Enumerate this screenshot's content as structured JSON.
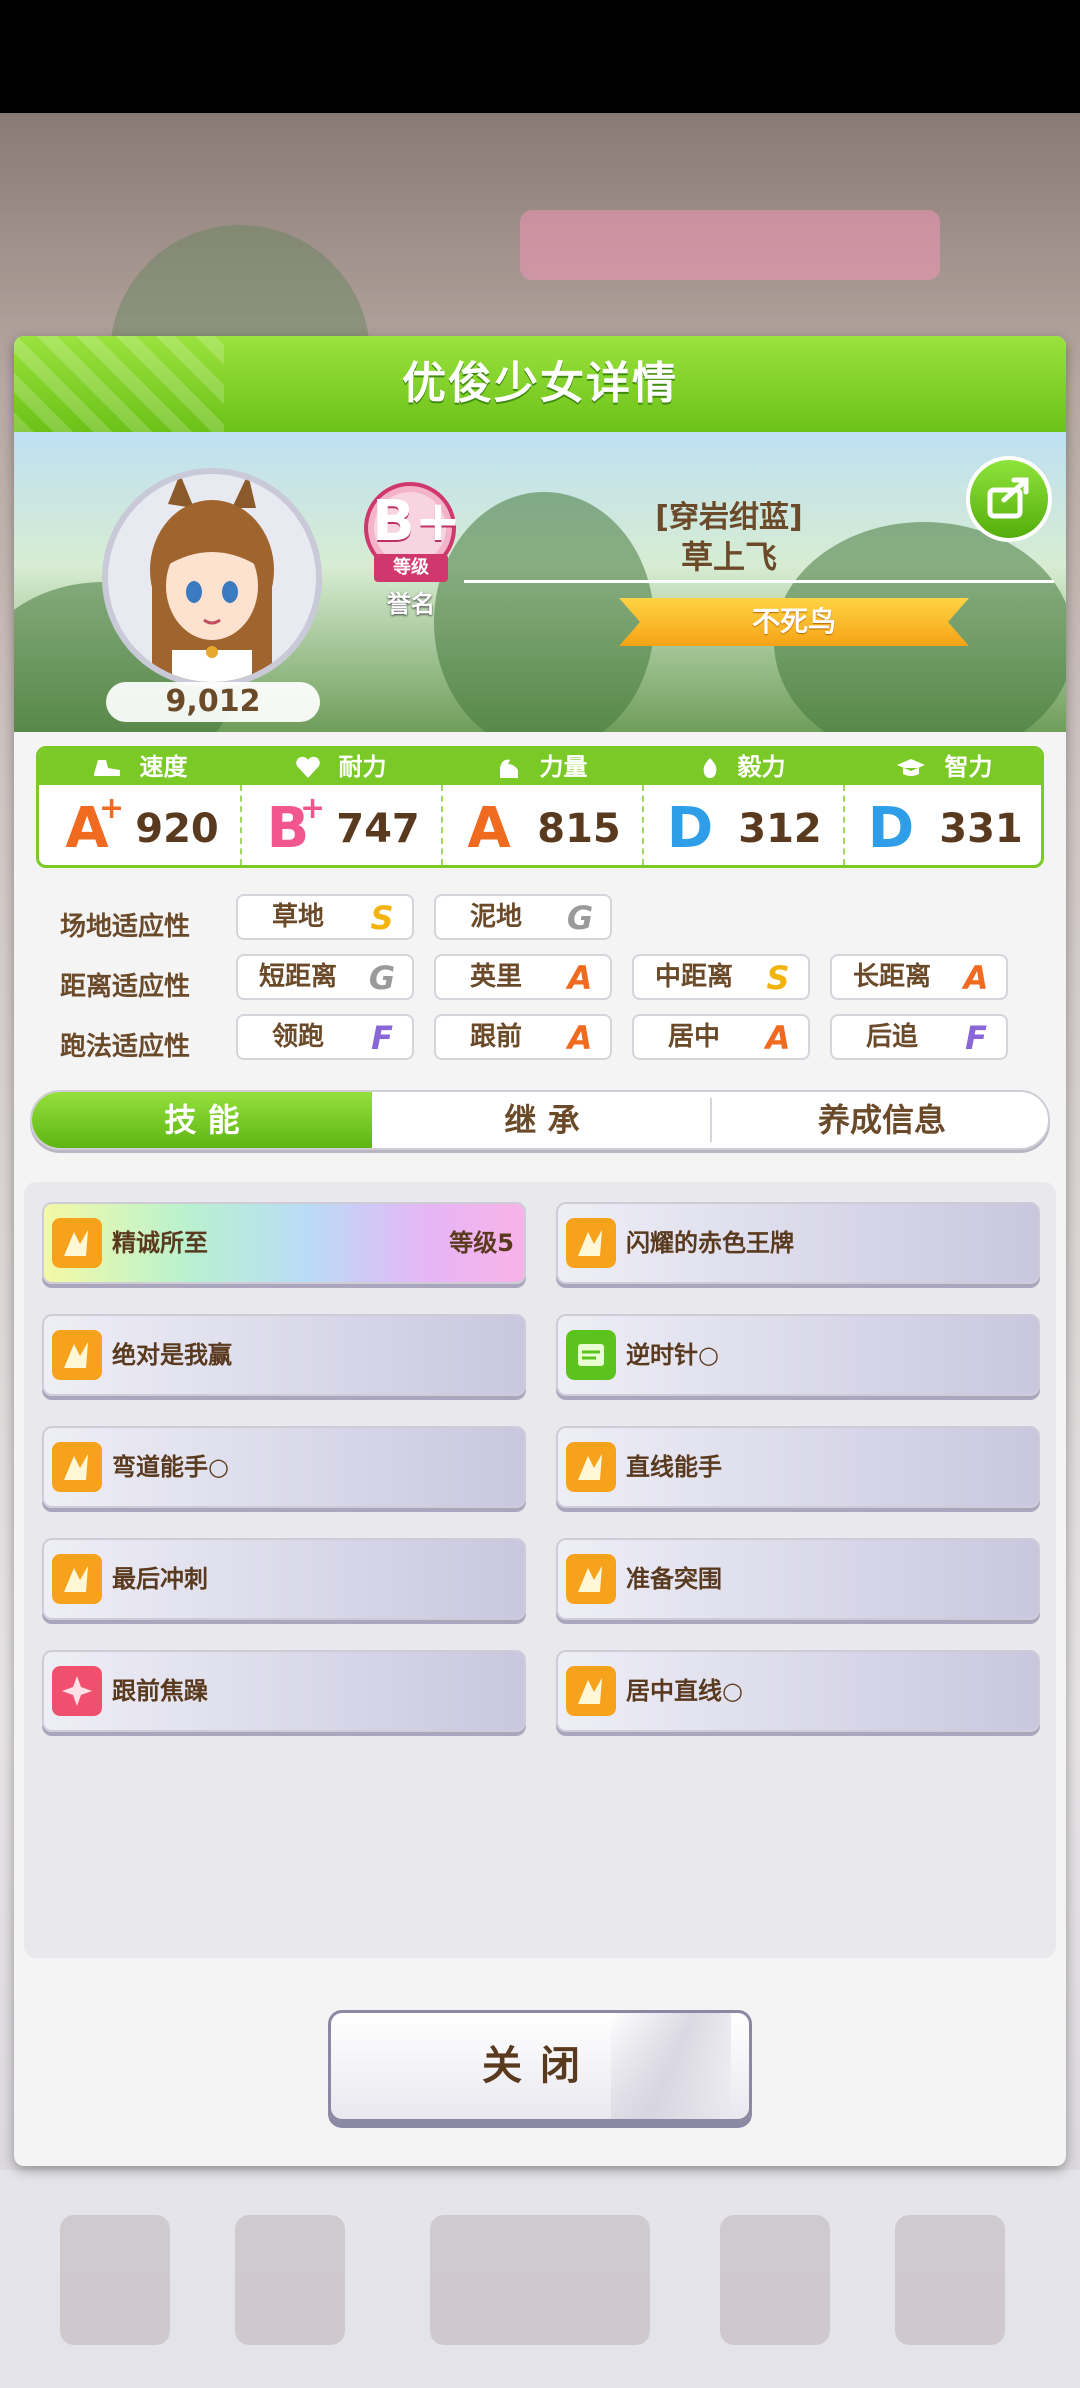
{
  "header": {
    "title": "优俊少女详情"
  },
  "profile": {
    "fans": "9,012",
    "rank": "B+",
    "rank_label": "等级",
    "reputation_label": "誉名",
    "epithet": "[穿岩绀蓝]",
    "name": "草上飞",
    "title": "不死鸟"
  },
  "stats": [
    {
      "label": "速度",
      "grade": "A",
      "plus": "+",
      "value": "920",
      "icon": "shoe-icon"
    },
    {
      "label": "耐力",
      "grade": "B",
      "plus": "+",
      "value": "747",
      "icon": "heart-icon"
    },
    {
      "label": "力量",
      "grade": "A",
      "plus": "",
      "value": "815",
      "icon": "muscle-icon"
    },
    {
      "label": "毅力",
      "grade": "D",
      "plus": "",
      "value": "312",
      "icon": "flame-icon"
    },
    {
      "label": "智力",
      "grade": "D",
      "plus": "",
      "value": "331",
      "icon": "graduation-cap-icon"
    }
  ],
  "aptitudes": {
    "track": {
      "label": "场地适应性",
      "items": [
        {
          "name": "草地",
          "grade": "S"
        },
        {
          "name": "泥地",
          "grade": "G"
        }
      ]
    },
    "distance": {
      "label": "距离适应性",
      "items": [
        {
          "name": "短距离",
          "grade": "G"
        },
        {
          "name": "英里",
          "grade": "A"
        },
        {
          "name": "中距离",
          "grade": "S"
        },
        {
          "name": "长距离",
          "grade": "A"
        }
      ]
    },
    "style": {
      "label": "跑法适应性",
      "items": [
        {
          "name": "领跑",
          "grade": "F"
        },
        {
          "name": "跟前",
          "grade": "A"
        },
        {
          "name": "居中",
          "grade": "A"
        },
        {
          "name": "后追",
          "grade": "F"
        }
      ]
    }
  },
  "tabs": [
    {
      "label": "技 能",
      "active": true
    },
    {
      "label": "继 承"
    },
    {
      "label": "养成信息"
    }
  ],
  "skills": [
    {
      "name": "精诚所至",
      "level": "等级5",
      "icon": "speed-skill-icon",
      "style": "rainbow"
    },
    {
      "name": "闪耀的赤色王牌",
      "level": "",
      "icon": "speed-skill-icon"
    },
    {
      "name": "绝对是我赢",
      "level": "",
      "icon": "speed-skill-icon"
    },
    {
      "name": "逆时针○",
      "level": "",
      "icon": "recovery-skill-icon"
    },
    {
      "name": "弯道能手○",
      "level": "",
      "icon": "speed-skill-icon"
    },
    {
      "name": "直线能手",
      "level": "",
      "icon": "speed-skill-icon"
    },
    {
      "name": "最后冲刺",
      "level": "",
      "icon": "speed-skill-icon"
    },
    {
      "name": "准备突围",
      "level": "",
      "icon": "speed-skill-icon"
    },
    {
      "name": "跟前焦躁",
      "level": "",
      "icon": "debuff-skill-icon"
    },
    {
      "name": "居中直线○",
      "level": "",
      "icon": "speed-skill-icon"
    }
  ],
  "close_button": {
    "label": "关闭"
  },
  "colors": {
    "accent_green": "#7ac926",
    "text_brown": "#6b4a2a",
    "grade_A": "#f06a1f",
    "grade_B": "#f2568f",
    "grade_D": "#2f9ee8",
    "grade_S": "#f2b40c",
    "grade_G": "#9a9a9a",
    "grade_F": "#8a67d6"
  }
}
